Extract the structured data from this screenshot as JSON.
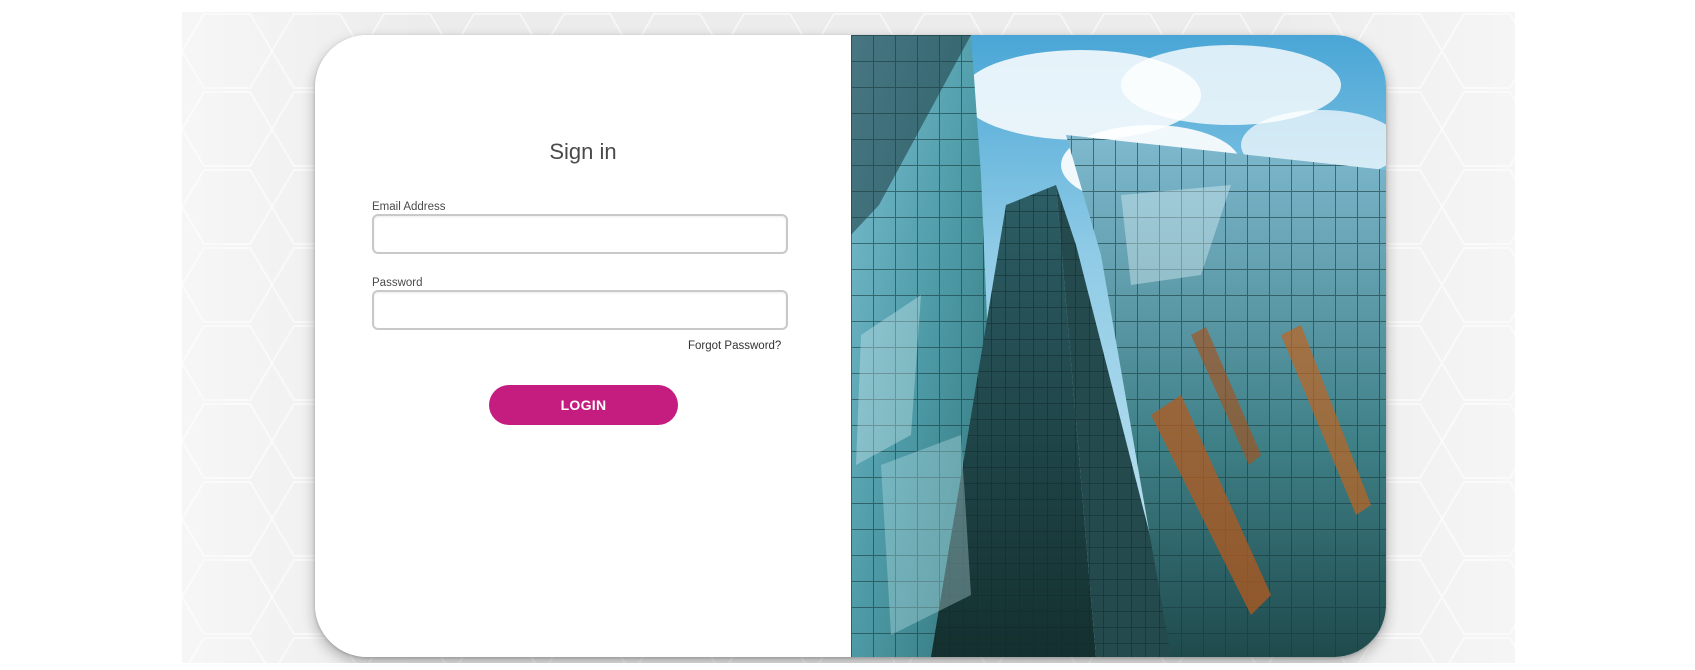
{
  "login_form": {
    "title": "Sign in",
    "email_label": "Email Address",
    "email_value": "",
    "password_label": "Password",
    "password_value": "",
    "forgot_link": "Forgot Password?",
    "login_button": "LOGIN"
  },
  "hero_image": {
    "subject": "glass skyscraper viewed from below against a cloudy sky"
  },
  "colors": {
    "accent": "#c41c7f",
    "page_background": "#ececec",
    "card_background": "#ffffff",
    "sky": "#5fb2d9",
    "glass": "#4f9aa0"
  }
}
